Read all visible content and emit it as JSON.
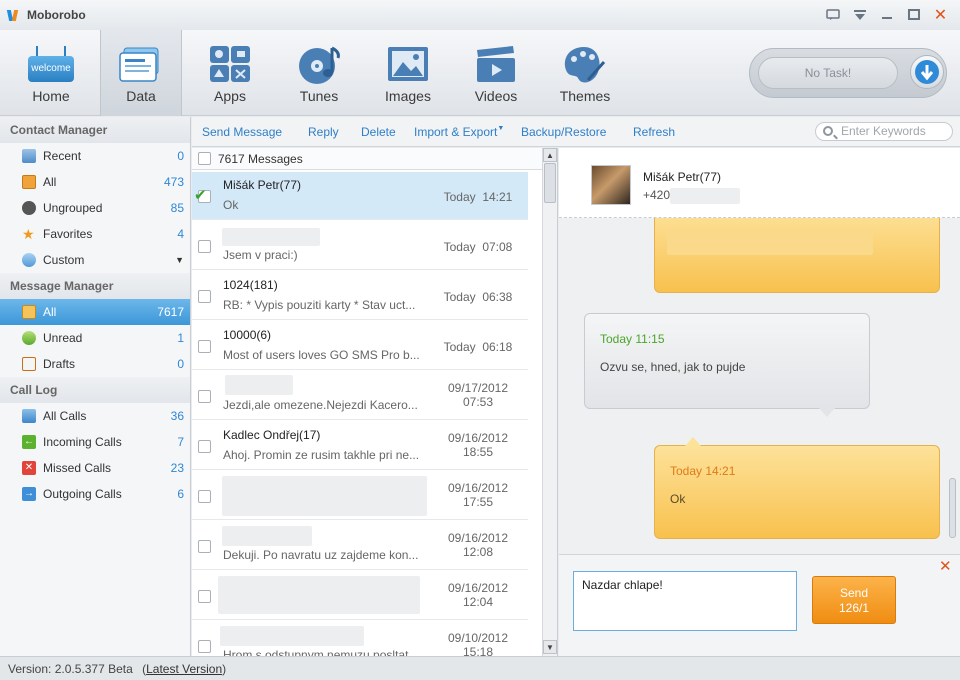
{
  "window": {
    "title": "Moborobo"
  },
  "nav": [
    {
      "label": "Home",
      "icon": "welcome-icon",
      "badge": "welcome"
    },
    {
      "label": "Data",
      "icon": "data-icon"
    },
    {
      "label": "Apps",
      "icon": "apps-icon"
    },
    {
      "label": "Tunes",
      "icon": "tunes-icon"
    },
    {
      "label": "Images",
      "icon": "images-icon"
    },
    {
      "label": "Videos",
      "icon": "videos-icon"
    },
    {
      "label": "Themes",
      "icon": "themes-icon"
    }
  ],
  "task": {
    "label": "No Task!"
  },
  "actions": {
    "send_message": "Send Message",
    "reply": "Reply",
    "delete": "Delete",
    "import_export": "Import & Export",
    "backup_restore": "Backup/Restore",
    "refresh": "Refresh",
    "search_placeholder": "Enter Keywords"
  },
  "sidebar": {
    "contact_header": "Contact Manager",
    "contacts": [
      {
        "name": "Recent",
        "count": "0"
      },
      {
        "name": "All",
        "count": "473"
      },
      {
        "name": "Ungrouped",
        "count": "85"
      },
      {
        "name": "Favorites",
        "count": "4"
      },
      {
        "name": "Custom",
        "count": ""
      }
    ],
    "message_header": "Message Manager",
    "messages": [
      {
        "name": "All",
        "count": "7617"
      },
      {
        "name": "Unread",
        "count": "1"
      },
      {
        "name": "Drafts",
        "count": "0"
      }
    ],
    "call_header": "Call Log",
    "calls": [
      {
        "name": "All Calls",
        "count": "36"
      },
      {
        "name": "Incoming Calls",
        "count": "7"
      },
      {
        "name": "Missed Calls",
        "count": "23"
      },
      {
        "name": "Outgoing Calls",
        "count": "6"
      }
    ]
  },
  "list": {
    "header": "7617 Messages",
    "rows": [
      {
        "who": "Mišák Petr(77)",
        "snippet": "Ok",
        "date": "Today",
        "time": "14:21"
      },
      {
        "who": "",
        "snippet": "Jsem v praci:)",
        "date": "Today",
        "time": "07:08"
      },
      {
        "who": "1024(181)",
        "snippet": "RB: * Vypis pouziti karty * Stav uct...",
        "date": "Today",
        "time": "06:38"
      },
      {
        "who": "10000(6)",
        "snippet": "Most of users loves GO SMS Pro b...",
        "date": "Today",
        "time": "06:18"
      },
      {
        "who": "",
        "snippet": "Jezdi,ale omezene.Nejezdi Kacero...",
        "date": "09/17/2012",
        "time": "07:53"
      },
      {
        "who": "Kadlec Ondřej(17)",
        "snippet": "Ahoj. Promin ze rusim takhle pri ne...",
        "date": "09/16/2012",
        "time": "18:55"
      },
      {
        "who": "",
        "snippet": "",
        "date": "09/16/2012",
        "time": "17:55"
      },
      {
        "who": "",
        "snippet": "Dekuji. Po navratu uz zajdeme kon...",
        "date": "09/16/2012",
        "time": "12:08"
      },
      {
        "who": "",
        "snippet": "",
        "date": "09/16/2012",
        "time": "12:04"
      },
      {
        "who": "",
        "snippet": "Hrom s odstupnym nemuzu posltat...",
        "date": "09/10/2012",
        "time": "15:18"
      }
    ]
  },
  "conversation": {
    "contact_name": "Mišák Petr(77)",
    "contact_number": "+420",
    "bubbles": [
      {
        "time": "Today  11:15",
        "text": "Ozvu se, hned, jak to pujde"
      },
      {
        "time": "Today  14:21",
        "text": "Ok"
      }
    ]
  },
  "compose": {
    "text": "Nazdar chlape!",
    "send_label": "Send",
    "send_count": "126/1"
  },
  "status": {
    "version": "Version: 2.0.5.377 Beta",
    "latest_link": "Latest Version",
    "open_paren": "(",
    "close_paren": ")"
  },
  "colors": {
    "accent": "#3c97d8",
    "link": "#2f7fc8",
    "outgoing": "#f8c14e",
    "incoming_time": "#4aa62a",
    "send": "#f08d12",
    "close": "#e0531f"
  }
}
